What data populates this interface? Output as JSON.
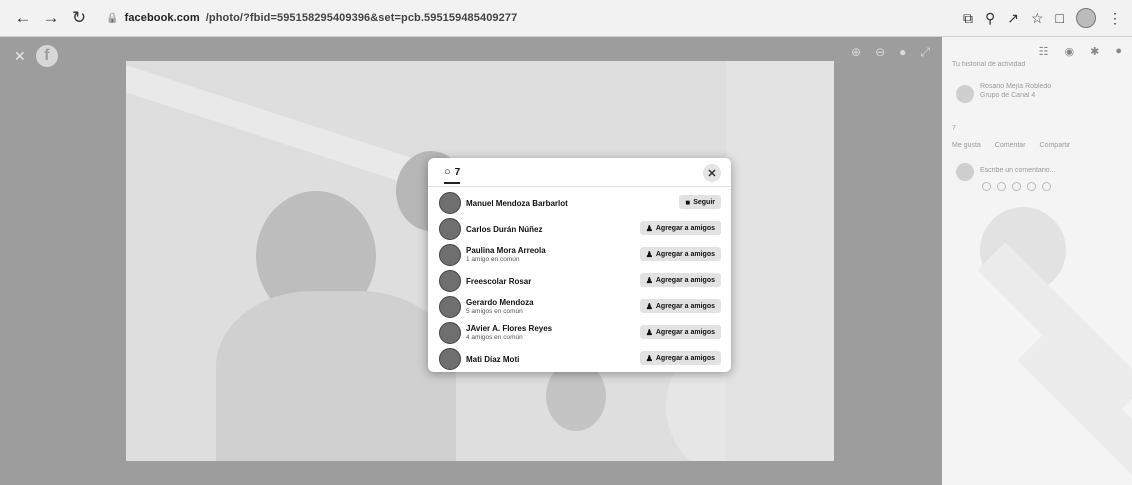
{
  "browser": {
    "back_icon": "arrow-left-icon",
    "forward_icon": "arrow-right-icon",
    "reload_icon": "reload-icon",
    "url_host": "facebook.com",
    "url_path": "/photo/?fbid=595158295409396&set=pcb.595159485409277"
  },
  "modal": {
    "tab_label": "7",
    "rows": [
      {
        "name": "Manuel Mendoza Barbarlot",
        "sub": "",
        "button": "Seguir"
      },
      {
        "name": "Carlos Durán Núñez",
        "sub": "",
        "button": "Agregar a amigos"
      },
      {
        "name": "Paulina Mora Arreola",
        "sub": "1 amigo en común",
        "button": "Agregar a amigos"
      },
      {
        "name": "Freescolar Rosar",
        "sub": "",
        "button": "Agregar a amigos"
      },
      {
        "name": "Gerardo Mendoza",
        "sub": "5 amigos en común",
        "button": "Agregar a amigos"
      },
      {
        "name": "JAvier A. Flores Reyes",
        "sub": "4 amigos en común",
        "button": "Agregar a amigos"
      },
      {
        "name": "Mati Díaz Moti",
        "sub": "",
        "button": "Agregar a amigos"
      }
    ]
  },
  "sidebar": {
    "line1": "Tu historial de actividad",
    "author_name": "Rosario Mejía Robledo",
    "author_sub": "Grupo de Canal 4",
    "likes_count": "7",
    "actions": [
      "Me gusta",
      "Comentar",
      "Compartir"
    ],
    "comment_placeholder": "Escribe un comentario..."
  }
}
